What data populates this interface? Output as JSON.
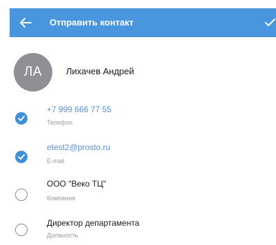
{
  "header": {
    "title": "Отправить контакт",
    "accent_color": "#4a96de"
  },
  "contact": {
    "initials": "ЛА",
    "name": "Лихачев Андрей",
    "avatar_color": "#8f9096"
  },
  "fields": [
    {
      "value": "+7 999 666 77 55",
      "label": "Телефон",
      "checked": true
    },
    {
      "value": "etest2@prosto.ru",
      "label": "E-mail",
      "checked": true
    },
    {
      "value": "ООО \"Веко ТЦ\"",
      "label": "Компания",
      "checked": false
    },
    {
      "value": "Директор департамента",
      "label": "Должность",
      "checked": false
    }
  ],
  "icons": {
    "back": "arrow-left-icon",
    "confirm": "check-icon",
    "selected": "checkmark-icon"
  }
}
